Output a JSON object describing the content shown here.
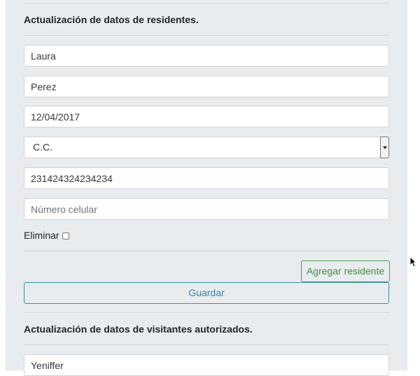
{
  "residents": {
    "title": "Actualización de datos de residentes.",
    "first_name": "Laura",
    "last_name": "Perez",
    "birth_date": "12/04/2017",
    "document_type": "C.C.",
    "document_number": "231424324234234",
    "phone_placeholder": "Número celular",
    "delete_label": "Eliminar",
    "add_resident_label": "Agregar residente",
    "save_label": "Guardar"
  },
  "visitors": {
    "title": "Actualización de datos de visitantes autorizados.",
    "first_name": "Yeniffer"
  }
}
